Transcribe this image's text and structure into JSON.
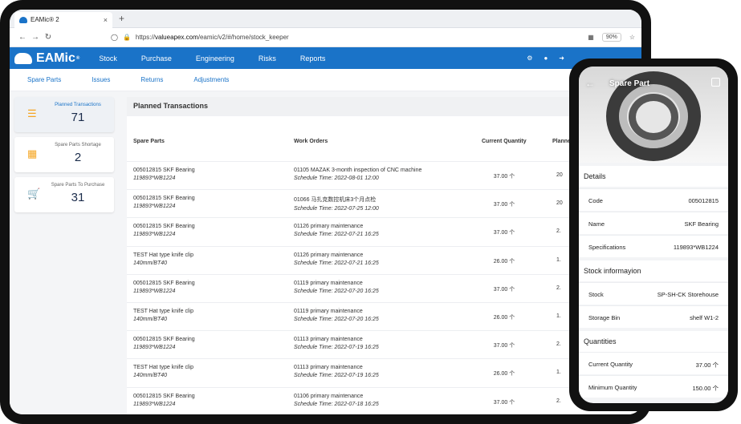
{
  "browser": {
    "tab_title": "EAMic® 2",
    "tab_close": "×",
    "new_tab": "+",
    "url_prefix": "https://",
    "url_domain": "valueapex.com",
    "url_path": "/eamic/v2/#/home/stock_keeper",
    "zoom": "90%"
  },
  "app": {
    "brand": "EAMic",
    "brand_mark": "®",
    "menu": [
      "Stock",
      "Purchase",
      "Engineering",
      "Risks",
      "Reports"
    ],
    "subnav": [
      "Spare Parts",
      "Issues",
      "Returns",
      "Adjustments"
    ]
  },
  "sidebar": {
    "cards": [
      {
        "label": "Planned Transactions",
        "value": "71",
        "icon": "list-icon"
      },
      {
        "label": "Spare Parts Shortage",
        "value": "2",
        "icon": "calculator-icon"
      },
      {
        "label": "Spare Parts To Purchase",
        "value": "31",
        "icon": "cart-icon"
      }
    ]
  },
  "table": {
    "title": "Planned Transactions",
    "columns": [
      "Spare Parts",
      "Work Orders",
      "Current Quantity",
      "Planned"
    ],
    "rows": [
      {
        "part": "005012815 SKF Bearing",
        "spec": "119893*WB1224",
        "wo": "01105 MAZAK 3-month inspection of CNC machine",
        "time": "Schedule Time: 2022-08-01 12:00",
        "qty": "37.00 个",
        "planned": "20"
      },
      {
        "part": "005012815 SKF Bearing",
        "spec": "119893*WB1224",
        "wo": "01066 马扎克数控机床3个月点检",
        "time": "Schedule Time: 2022-07-25 12:00",
        "qty": "37.00 个",
        "planned": "20"
      },
      {
        "part": "005012815 SKF Bearing",
        "spec": "119893*WB1224",
        "wo": "01126 primary maintenance",
        "time": "Schedule Time: 2022-07-21 16:25",
        "qty": "37.00 个",
        "planned": "2."
      },
      {
        "part": "TEST Hat type knife clip",
        "spec": "140mm/BT40",
        "wo": "01126 primary maintenance",
        "time": "Schedule Time: 2022-07-21 16:25",
        "qty": "26.00 个",
        "planned": "1."
      },
      {
        "part": "005012815 SKF Bearing",
        "spec": "119893*WB1224",
        "wo": "01119 primary maintenance",
        "time": "Schedule Time: 2022-07-20 16:25",
        "qty": "37.00 个",
        "planned": "2."
      },
      {
        "part": "TEST Hat type knife clip",
        "spec": "140mm/BT40",
        "wo": "01119 primary maintenance",
        "time": "Schedule Time: 2022-07-20 16:25",
        "qty": "26.00 个",
        "planned": "1."
      },
      {
        "part": "005012815 SKF Bearing",
        "spec": "119893*WB1224",
        "wo": "01113 primary maintenance",
        "time": "Schedule Time: 2022-07-19 16:25",
        "qty": "37.00 个",
        "planned": "2."
      },
      {
        "part": "TEST Hat type knife clip",
        "spec": "140mm/BT40",
        "wo": "01113 primary maintenance",
        "time": "Schedule Time: 2022-07-19 16:25",
        "qty": "26.00 个",
        "planned": "1."
      },
      {
        "part": "005012815 SKF Bearing",
        "spec": "119893*WB1224",
        "wo": "01106 primary maintenance",
        "time": "Schedule Time: 2022-07-18 16:25",
        "qty": "37.00 个",
        "planned": "2."
      }
    ]
  },
  "phone": {
    "title": "Spare Part",
    "back": "←",
    "details_title": "Details",
    "details": [
      {
        "k": "Code",
        "v": "005012815"
      },
      {
        "k": "Name",
        "v": "SKF Bearing"
      },
      {
        "k": "Specifications",
        "v": "119893*WB1224"
      }
    ],
    "stock_title": "Stock informayion",
    "stock": [
      {
        "k": "Stock",
        "v": "SP-SH-CK Storehouse"
      },
      {
        "k": "Storage Bin",
        "v": "shelf W1-2"
      }
    ],
    "qty_title": "Quantities",
    "quantities": [
      {
        "k": "Current Quantity",
        "v": "37.00 个"
      },
      {
        "k": "Minimum Quantity",
        "v": "150.00 个"
      }
    ]
  }
}
